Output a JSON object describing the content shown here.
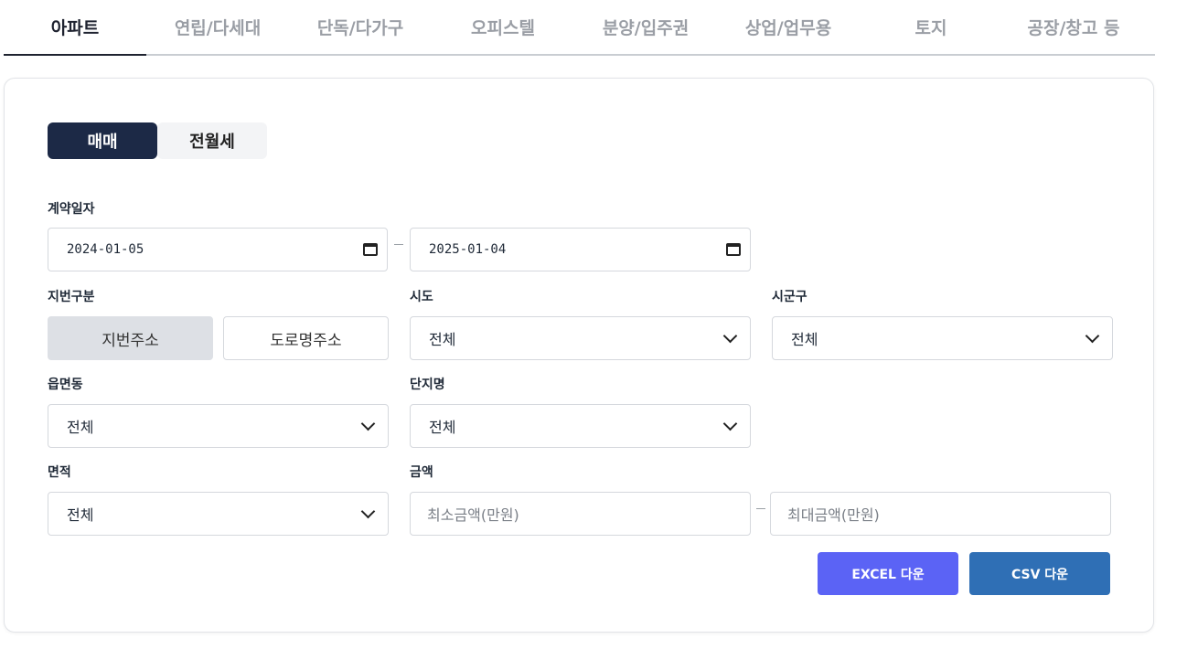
{
  "tabs": [
    "아파트",
    "연립/다세대",
    "단독/다가구",
    "오피스텔",
    "분양/입주권",
    "상업/업무용",
    "토지",
    "공장/창고 등"
  ],
  "deal_type": {
    "buy": "매매",
    "rent": "전월세"
  },
  "contract_date": {
    "label": "계약일자",
    "start": "2024-01-05",
    "end": "2025-01-04"
  },
  "address_type": {
    "label": "지번구분",
    "lot": "지번주소",
    "road": "도로명주소"
  },
  "sido": {
    "label": "시도",
    "value": "전체"
  },
  "sigungu": {
    "label": "시군구",
    "value": "전체"
  },
  "eupmyeondong": {
    "label": "읍면동",
    "value": "전체"
  },
  "complex": {
    "label": "단지명",
    "value": "전체"
  },
  "area": {
    "label": "면적",
    "value": "전체"
  },
  "price": {
    "label": "금액",
    "min_placeholder": "최소금액(만원)",
    "max_placeholder": "최대금액(만원)"
  },
  "buttons": {
    "excel": "EXCEL 다운",
    "csv": "CSV 다운"
  },
  "colors": {
    "dark_navy": "#1c2946",
    "excel": "#5b63f5",
    "csv": "#2f6fb5"
  }
}
